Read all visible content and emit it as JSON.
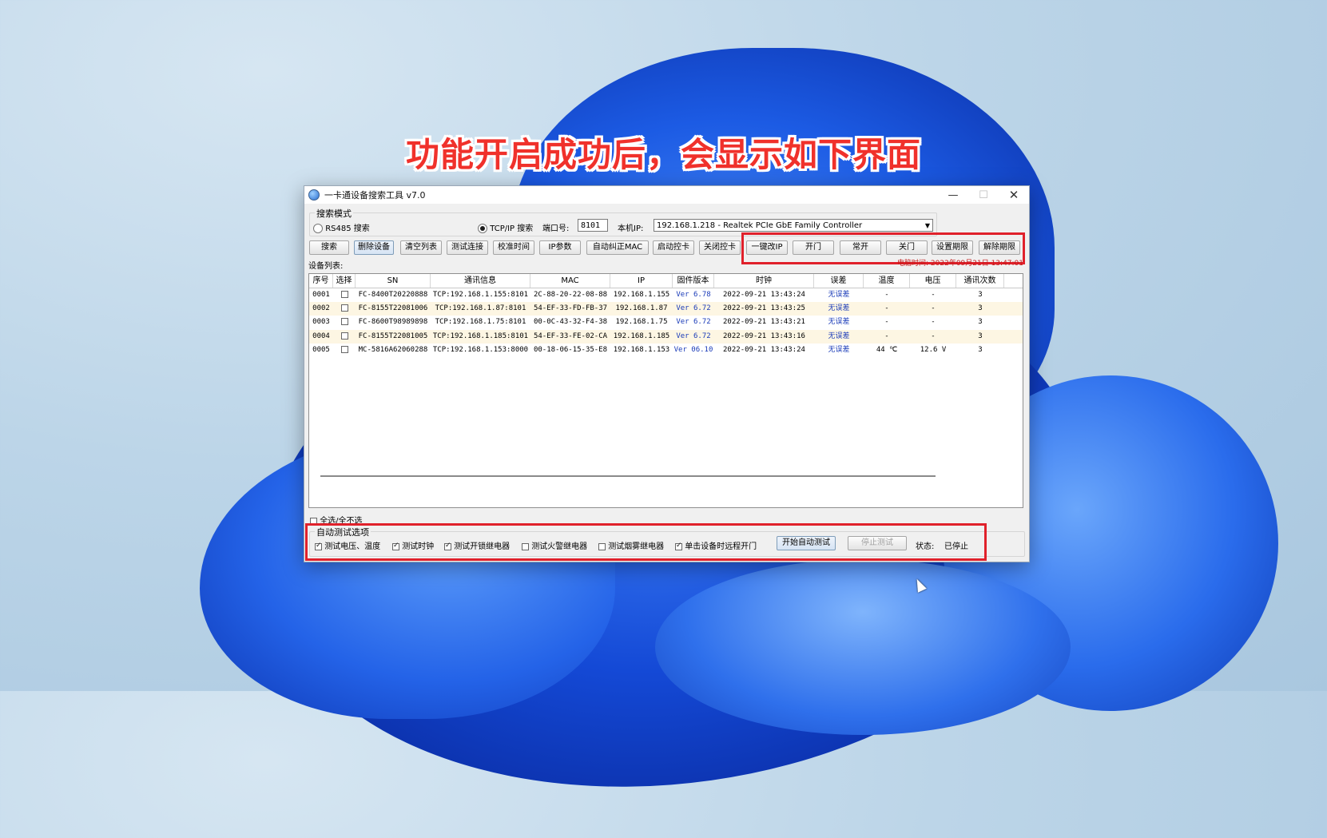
{
  "caption": "功能开启成功后，会显示如下界面",
  "window": {
    "title": "一卡通设备搜索工具 v7.0",
    "controls": {
      "minimize": "—",
      "maximize": "☐",
      "close": "✕"
    }
  },
  "search_mode": {
    "group_label": "搜索模式",
    "rs485_label": "RS485 搜索",
    "tcpip_label": "TCP/IP 搜索",
    "port_label": "端口号:",
    "port_value": "8101",
    "local_ip_label": "本机IP:",
    "local_ip_value": "192.168.1.218 - Realtek PCIe GbE Family Controller"
  },
  "toolbar": {
    "buttons": [
      "搜索",
      "删除设备",
      "清空列表",
      "测试连接",
      "校准时间",
      "IP参数",
      "自动纠正MAC",
      "启动控卡",
      "关闭控卡",
      "一键改IP",
      "开门",
      "常开",
      "关门",
      "设置期限",
      "解除期限"
    ]
  },
  "device_list": {
    "label": "设备列表:",
    "clock_text": "电脑时间: 2022年09月21日 13:47:01",
    "columns": [
      "序号",
      "选择",
      "SN",
      "通讯信息",
      "MAC",
      "IP",
      "固件版本",
      "时钟",
      "误差",
      "温度",
      "电压",
      "通讯次数"
    ],
    "rows": [
      {
        "no": "0001",
        "sn": "FC-8400T20220888",
        "comm": "TCP:192.168.1.155:8101",
        "mac": "2C-88-20-22-08-88",
        "ip": "192.168.1.155",
        "ver": "Ver  6.78",
        "clock": "2022-09-21 13:43:24",
        "err": "无误差",
        "temp": "-",
        "volt": "-",
        "count": "3"
      },
      {
        "no": "0002",
        "sn": "FC-8155T22081006",
        "comm": "TCP:192.168.1.87:8101",
        "mac": "54-EF-33-FD-FB-37",
        "ip": "192.168.1.87",
        "ver": "Ver  6.72",
        "clock": "2022-09-21 13:43:25",
        "err": "无误差",
        "temp": "-",
        "volt": "-",
        "count": "3"
      },
      {
        "no": "0003",
        "sn": "FC-8600T98989898",
        "comm": "TCP:192.168.1.75:8101",
        "mac": "00-0C-43-32-F4-38",
        "ip": "192.168.1.75",
        "ver": "Ver  6.72",
        "clock": "2022-09-21 13:43:21",
        "err": "无误差",
        "temp": "-",
        "volt": "-",
        "count": "3"
      },
      {
        "no": "0004",
        "sn": "FC-8155T22081005",
        "comm": "TCP:192.168.1.185:8101",
        "mac": "54-EF-33-FE-02-CA",
        "ip": "192.168.1.185",
        "ver": "Ver  6.72",
        "clock": "2022-09-21 13:43:16",
        "err": "无误差",
        "temp": "-",
        "volt": "-",
        "count": "3"
      },
      {
        "no": "0005",
        "sn": "MC-5816A62060288",
        "comm": "TCP:192.168.1.153:8000",
        "mac": "00-18-06-15-35-E8",
        "ip": "192.168.1.153",
        "ver": "Ver 06.10",
        "clock": "2022-09-21 13:43:24",
        "err": "无误差",
        "temp": "44 ℃",
        "volt": "12.6 V",
        "count": "3"
      }
    ]
  },
  "select_all_label": "全选/全不选",
  "auto_test": {
    "group_label": "自动测试选项",
    "opt1": "测试电压、温度",
    "opt2": "测试时钟",
    "opt3": "测试开锁继电器",
    "opt4": "测试火警继电器",
    "opt5": "测试烟雾继电器",
    "opt6": "单击设备时远程开门",
    "start_button": "开始自动测试",
    "stop_button": "停止测试",
    "status_label": "状态:",
    "status_value": "已停止"
  }
}
